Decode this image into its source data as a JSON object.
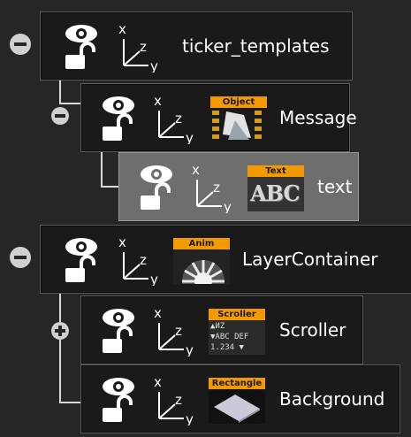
{
  "scene_tree": {
    "nodes": [
      {
        "id": "ticker_templates",
        "label": "ticker_templates",
        "thumb_label": "",
        "toggle": "collapse",
        "selected": false
      },
      {
        "id": "message",
        "label": "Message",
        "thumb_label": "Object",
        "toggle": "collapse",
        "selected": false
      },
      {
        "id": "text",
        "label": "text",
        "thumb_label": "Text",
        "toggle": "",
        "selected": true
      },
      {
        "id": "layercontainer",
        "label": "LayerContainer",
        "thumb_label": "Anim",
        "toggle": "collapse",
        "selected": false
      },
      {
        "id": "scroller",
        "label": "Scroller",
        "thumb_label": "Scroller",
        "toggle": "expand",
        "selected": false
      },
      {
        "id": "background",
        "label": "Background",
        "thumb_label": "Rectangle",
        "toggle": "",
        "selected": false
      }
    ],
    "axis_letters": {
      "x": "x",
      "y": "y",
      "z": "z"
    },
    "thumb_text": {
      "text": "ABC",
      "scroller_lines": [
        "▲ИZ",
        "▼ABC DEF",
        "1.234 ▼"
      ]
    }
  },
  "colors": {
    "background": "#262626",
    "row": "#1a1a1a",
    "selected_row": "#6e6e6e",
    "thumb_tab": "#f39a00",
    "icon": "#ffffff"
  },
  "icons": [
    "collapse-icon",
    "expand-icon",
    "eye-icon",
    "lock-open-icon",
    "axis-icon"
  ]
}
